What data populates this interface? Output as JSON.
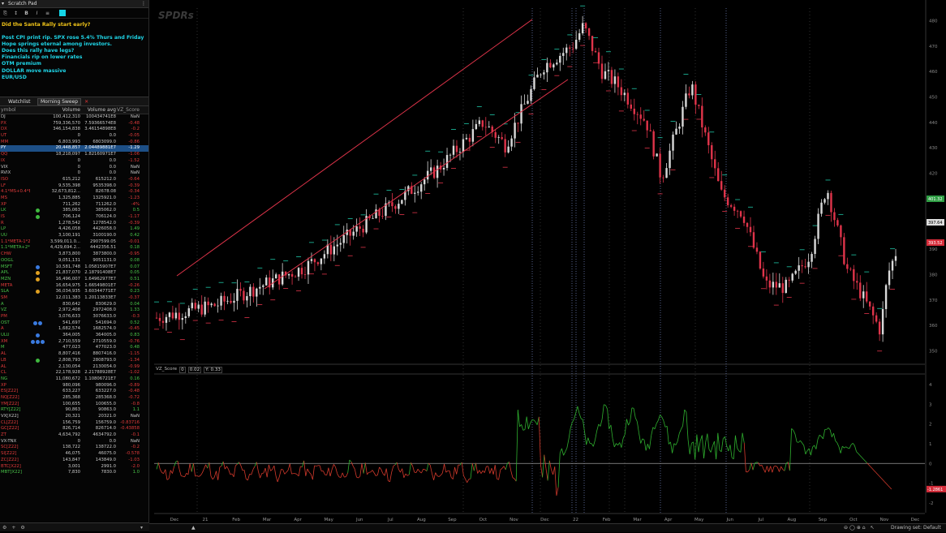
{
  "scratch_pad": {
    "title": "Scratch Pad",
    "toolbar": [
      "B",
      "I"
    ],
    "question": "Did the Santa Rally start early?",
    "lines": [
      "Post CPI print rip. SPX rose 5.4% Thurs and Friday",
      "Hope springs eternal among investors.",
      "Does this rally have legs?",
      "Financials rip on lower rates",
      "OTM premium",
      "DOLLAR move massive",
      "EUR/USD"
    ]
  },
  "watchlist": {
    "title": "Watchlist",
    "name": "Morning Sweep",
    "columns": [
      "ymbol",
      "Volume",
      "Volume avg",
      "VZ_Score"
    ],
    "rows": [
      {
        "sym": "DJ",
        "vol": "100,412,310",
        "avg": "100434741E8",
        "z": "NaN",
        "color": "#c8c8c8"
      },
      {
        "sym": "PX",
        "vol": "759,336,570",
        "avg": "7.59366574E8",
        "z": "-0.48",
        "color": "#e23b3b"
      },
      {
        "sym": "DX",
        "vol": "346,154,838",
        "avg": "3.46154898E8",
        "z": "-0.2",
        "color": "#e23b3b"
      },
      {
        "sym": "UT",
        "vol": "0",
        "avg": "0.0",
        "z": "-0.05",
        "color": "#e23b3b"
      },
      {
        "sym": "MM",
        "vol": "6,803,993",
        "avg": "6803099.0",
        "z": "-0.86",
        "color": "#e23b3b"
      },
      {
        "sym": "PY",
        "vol": "20,448,857",
        "avg": "2.04489881E7",
        "z": "-1.29",
        "color": "#ffffff",
        "selected": true
      },
      {
        "sym": "QQ",
        "vol": "18,218,097",
        "avg": "1.82160971E7",
        "z": "-1.06",
        "color": "#e23b3b"
      },
      {
        "sym": "IX",
        "vol": "0",
        "avg": "0.0",
        "z": "-1.52",
        "color": "#e23b3b"
      },
      {
        "sym": "VIX",
        "vol": "0",
        "avg": "0.0",
        "z": "NaN",
        "color": "#c8c8c8"
      },
      {
        "sym": "RVIX",
        "vol": "0",
        "avg": "0.0",
        "z": "NaN",
        "color": "#c8c8c8"
      },
      {
        "sym": "ISO",
        "vol": "615,212",
        "avg": "615212.0",
        "z": "-0.64",
        "color": "#e23b3b"
      },
      {
        "sym": "LF",
        "vol": "9,535,398",
        "avg": "9535398.0",
        "z": "-0.39",
        "color": "#e23b3b"
      },
      {
        "sym": "4.1*MS+0.4*BL...",
        "vol": "32,673,812...",
        "avg": "82678.08",
        "z": "-0.34",
        "color": "#e23b3b"
      },
      {
        "sym": "MS",
        "vol": "1,325,885",
        "avg": "1325921.0",
        "z": "-1.23",
        "color": "#e23b3b"
      },
      {
        "sym": "XP",
        "vol": "711,262",
        "avg": "711262.0",
        "z": "-4%",
        "color": "#e23b3b"
      },
      {
        "sym": "LK",
        "vol": "385,063",
        "avg": "385062.0",
        "z": "0.5",
        "color": "#49c449",
        "badge": "#3fb93f"
      },
      {
        "sym": "IS",
        "vol": "706,124",
        "avg": "706124.0",
        "z": "-1.17",
        "color": "#e23b3b",
        "badge": "#3fb93f"
      },
      {
        "sym": "R",
        "vol": "1,278,542",
        "avg": "1278542.0",
        "z": "-0.39",
        "color": "#e23b3b"
      },
      {
        "sym": "LP",
        "vol": "4,426,058",
        "avg": "4426058.0",
        "z": "1.49",
        "color": "#49c449"
      },
      {
        "sym": "UU",
        "vol": "3,100,191",
        "avg": "3100190.0",
        "z": "0.42",
        "color": "#49c449"
      },
      {
        "sym": "1.1*META-1*2P...",
        "vol": "3,599,011.0...",
        "avg": "2907599.05",
        "z": "-0.01",
        "color": "#e23b3b"
      },
      {
        "sym": "1.1*META+2*P...",
        "vol": "4,429,694.2...",
        "avg": "4442356.51",
        "z": "0.18",
        "color": "#49c449"
      },
      {
        "sym": "CHW",
        "vol": "3,873,800",
        "avg": "3873800.0",
        "z": "-0.95",
        "color": "#e23b3b"
      },
      {
        "sym": "OOGL",
        "vol": "9,051,131",
        "avg": "9051131.0",
        "z": "0.08",
        "color": "#49c449"
      },
      {
        "sym": "MSFT",
        "vol": "10,581,748",
        "avg": "1.05815907E7",
        "z": "0.07",
        "color": "#49c449",
        "badge": "#3a7be0"
      },
      {
        "sym": "APL",
        "vol": "21,837,070",
        "avg": "2.18791408E7",
        "z": "0.05",
        "color": "#49c449",
        "badge": "#e0a020"
      },
      {
        "sym": "MZN",
        "vol": "16,496,007",
        "avg": "1.64962977E7",
        "z": "0.51",
        "color": "#49c449",
        "badge": "#e0a020"
      },
      {
        "sym": "META",
        "vol": "16,654,975",
        "avg": "1.66549801E7",
        "z": "-0.26",
        "color": "#e23b3b"
      },
      {
        "sym": "SLA",
        "vol": "36,034,935",
        "avg": "3.60344771E7",
        "z": "0.23",
        "color": "#49c449",
        "badge": "#e0a020"
      },
      {
        "sym": "SM",
        "vol": "12,011,383",
        "avg": "1.20113833E7",
        "z": "-0.37",
        "color": "#e23b3b"
      },
      {
        "sym": "A",
        "vol": "830,642",
        "avg": "830629.0",
        "z": "0.04",
        "color": "#49c449"
      },
      {
        "sym": "VZ",
        "vol": "2,972,408",
        "avg": "2972408.0",
        "z": "1.33",
        "color": "#49c449"
      },
      {
        "sym": "PM",
        "vol": "3,076,633",
        "avg": "3076633.0",
        "z": "-0.3",
        "color": "#e23b3b"
      },
      {
        "sym": "OST",
        "vol": "541,697",
        "avg": "541694.0",
        "z": "0.52",
        "color": "#49c449",
        "badge": "#3a7be0",
        "badge2": "#3a7be0"
      },
      {
        "sym": "A",
        "vol": "1,682,574",
        "avg": "1682574.0",
        "z": "-0.45",
        "color": "#e23b3b"
      },
      {
        "sym": "ULU",
        "vol": "364,005",
        "avg": "364005.0",
        "z": "0.83",
        "color": "#49c449",
        "badge": "#3a7be0"
      },
      {
        "sym": "XM",
        "vol": "2,710,559",
        "avg": "2710559.0",
        "z": "-0.76",
        "color": "#e23b3b",
        "badge": "#3a7be0",
        "badge2": "#3a7be0",
        "badge3": "#3a7be0"
      },
      {
        "sym": "M",
        "vol": "477,023",
        "avg": "477023.0",
        "z": "0.48",
        "color": "#49c449"
      },
      {
        "sym": "AL",
        "vol": "8,807,416",
        "avg": "8807416.0",
        "z": "-1.15",
        "color": "#e23b3b"
      },
      {
        "sym": "LB",
        "vol": "2,808,793",
        "avg": "2808793.0",
        "z": "-1.34",
        "color": "#e23b3b",
        "badge": "#3fb93f"
      },
      {
        "sym": "AL",
        "vol": "2,130,054",
        "avg": "2130054.0",
        "z": "-0.99",
        "color": "#e23b3b"
      },
      {
        "sym": "CL",
        "vol": "22,178,928",
        "avg": "2.21788928E7",
        "z": "-1.02",
        "color": "#e23b3b"
      },
      {
        "sym": "NG",
        "vol": "11,080,672",
        "avg": "1.10806721E7",
        "z": "0.16",
        "color": "#49c449"
      },
      {
        "sym": "XP",
        "vol": "980,096",
        "avg": "980096.0",
        "z": "-0.89",
        "color": "#e23b3b"
      },
      {
        "sym": "ES[Z22]",
        "vol": "633,227",
        "avg": "633227.0",
        "z": "-0.48",
        "color": "#e23b3b"
      },
      {
        "sym": "NQ[Z22]",
        "vol": "285,368",
        "avg": "285368.0",
        "z": "-0.72",
        "color": "#e23b3b"
      },
      {
        "sym": "YM[Z22]",
        "vol": "100,655",
        "avg": "100655.0",
        "z": "-0.8",
        "color": "#e23b3b"
      },
      {
        "sym": "RTY[Z22]",
        "vol": "90,863",
        "avg": "90863.0",
        "z": "1.1",
        "color": "#49c449"
      },
      {
        "sym": "VX[X22]",
        "vol": "20,321",
        "avg": "20321.0",
        "z": "NaN",
        "color": "#c8c8c8"
      },
      {
        "sym": "CL[Z22]",
        "vol": "156,759",
        "avg": "156759.0",
        "z": "-0.83716",
        "color": "#e23b3b"
      },
      {
        "sym": "GC[Z22]",
        "vol": "826,714",
        "avg": "826714.0",
        "z": "-0.43858",
        "color": "#e23b3b"
      },
      {
        "sym": "ZT",
        "vol": "4,634,792",
        "avg": "4634792.0",
        "z": "-0.1",
        "color": "#e23b3b"
      },
      {
        "sym": "VX-TNX",
        "vol": "0",
        "avg": "0.0",
        "z": "NaN",
        "color": "#c8c8c8"
      },
      {
        "sym": "SC[Z22]",
        "vol": "138,722",
        "avg": "138722.0",
        "z": "-0.2",
        "color": "#e23b3b"
      },
      {
        "sym": "SI[Z22]",
        "vol": "46,075",
        "avg": "46075.0",
        "z": "-0.578",
        "color": "#e23b3b"
      },
      {
        "sym": "ZC[Z22]",
        "vol": "143,847",
        "avg": "143849.0",
        "z": "-1.03",
        "color": "#e23b3b"
      },
      {
        "sym": "BTC[X22]",
        "vol": "3,001",
        "avg": "2991.0",
        "z": "-2.0",
        "color": "#e23b3b"
      },
      {
        "sym": "MBT[X22]",
        "vol": "7,830",
        "avg": "7830.0",
        "z": "1.0",
        "color": "#49c449"
      }
    ]
  },
  "chart": {
    "watermark": "SPDRs",
    "indicator_label": "VZ_Score",
    "indicator_values": [
      "0",
      "0.02",
      "Y: 0.33"
    ],
    "price_ticks": [
      "480",
      "470",
      "460",
      "450",
      "440",
      "430",
      "420",
      "410",
      "400",
      "390",
      "380",
      "370",
      "360",
      "350"
    ],
    "price_badges": [
      {
        "text": "401.32",
        "color": "#2f9e44"
      },
      {
        "text": "397.64",
        "color": "#dddddd"
      },
      {
        "text": "393.52",
        "color": "#d62c3a"
      }
    ],
    "ind_ticks": [
      "4",
      "3",
      "2",
      "1",
      "0",
      "-1",
      "-2"
    ],
    "ind_badge": {
      "text": "-1.2861",
      "color": "#d62c3a"
    },
    "time_ticks": [
      "Dec",
      "21",
      "Feb",
      "Mar",
      "Apr",
      "May",
      "Jun",
      "Jul",
      "Aug",
      "Sep",
      "Oct",
      "Nov",
      "Dec",
      "22",
      "Feb",
      "Mar",
      "Apr",
      "May",
      "Jun",
      "Jul",
      "Aug",
      "Sep",
      "Oct",
      "Nov",
      "Dec"
    ],
    "status_text": "Drawing set: Default",
    "colors": {
      "up": "#d9d9d9",
      "down": "#e0344a",
      "channel": "#e0344a",
      "osc_pos": "#2fb02f",
      "osc_neg": "#d33a2c",
      "ma": "#1ec8a8"
    }
  },
  "statusbar": {
    "icons": [
      "gear-icon",
      "plus-icon",
      "chevron-down-icon"
    ]
  }
}
